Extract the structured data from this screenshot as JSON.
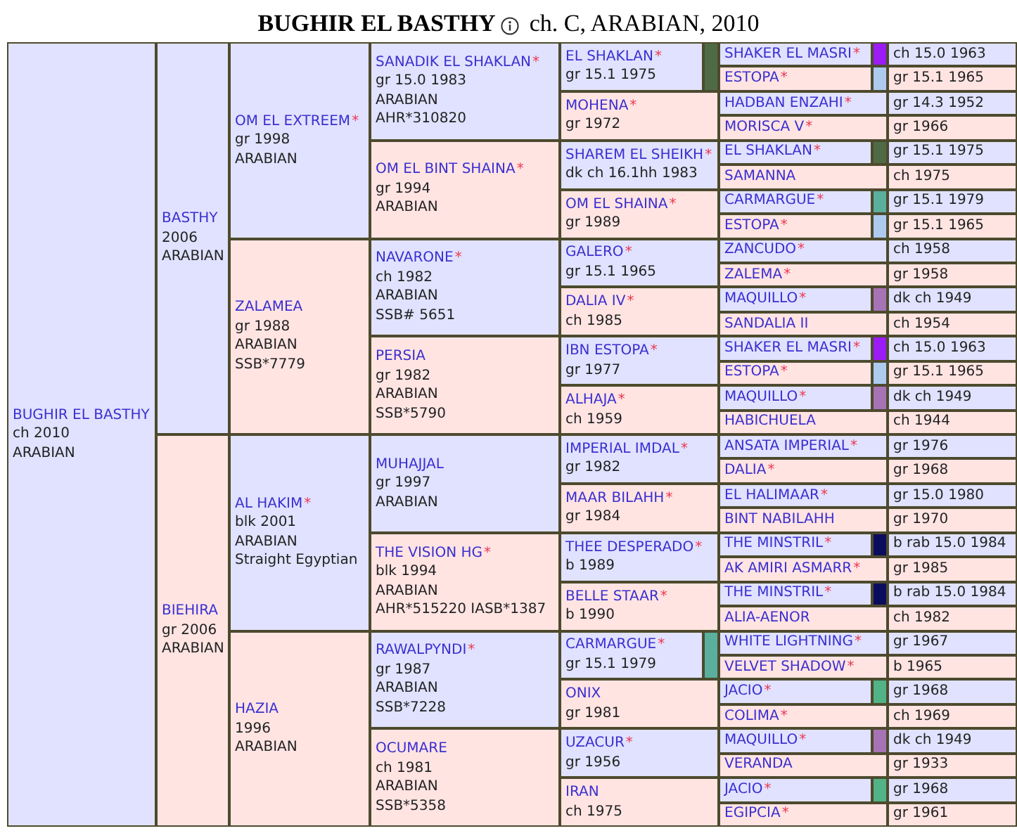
{
  "title": {
    "name": "BUGHIR EL BASTHY",
    "summary": "ch. C, ARABIAN, 2010"
  },
  "pedigree": {
    "name": "BUGHIR EL BASTHY",
    "lines": [
      "ch 2010",
      "ARABIAN"
    ],
    "parents": [
      {
        "name": "BASTHY",
        "lines": [
          "2006",
          "ARABIAN"
        ],
        "parents": [
          {
            "name": "OM EL EXTREEM",
            "star": "*",
            "lines": [
              "gr 1998",
              "ARABIAN"
            ],
            "parents": [
              {
                "name": "SANADIK EL SHAKLAN",
                "star": "*",
                "lines": [
                  "gr 15.0 1983",
                  "ARABIAN",
                  "AHR*310820"
                ],
                "parents": [
                  {
                    "name": "EL SHAKLAN",
                    "star": "*",
                    "lines": [
                      "gr 15.1 1975"
                    ],
                    "color": "#4f6b45",
                    "parents": [
                      {
                        "name": "SHAKER EL MASRI",
                        "star": "*",
                        "lines": [
                          "ch 15.0 1963"
                        ],
                        "color": "#9b1cf5"
                      },
                      {
                        "name": "ESTOPA",
                        "star": "*",
                        "lines": [
                          "gr 15.1 1965"
                        ],
                        "color": "#aecbef"
                      }
                    ]
                  },
                  {
                    "name": "MOHENA",
                    "star": "*",
                    "lines": [
                      "gr 1972"
                    ],
                    "parents": [
                      {
                        "name": "HADBAN ENZAHI",
                        "star": "*",
                        "lines": [
                          "gr 14.3 1952"
                        ]
                      },
                      {
                        "name": "MORISCA V",
                        "star": "*",
                        "lines": [
                          "gr 1966"
                        ]
                      }
                    ]
                  }
                ]
              },
              {
                "name": "OM EL BINT SHAINA",
                "star": "*",
                "lines": [
                  "gr 1994",
                  "ARABIAN"
                ],
                "parents": [
                  {
                    "name": "SHAREM EL SHEIKH",
                    "star": "*",
                    "lines": [
                      "dk ch 16.1hh 1983"
                    ],
                    "parents": [
                      {
                        "name": "EL SHAKLAN",
                        "star": "*",
                        "lines": [
                          "gr 15.1 1975"
                        ],
                        "color": "#4f6b45"
                      },
                      {
                        "name": "SAMANNA",
                        "lines": [
                          "ch 1975"
                        ]
                      }
                    ]
                  },
                  {
                    "name": "OM EL SHAINA",
                    "star": "*",
                    "lines": [
                      "gr 1989"
                    ],
                    "parents": [
                      {
                        "name": "CARMARGUE",
                        "star": "*",
                        "lines": [
                          "gr 15.1 1979"
                        ],
                        "color": "#5aaf9d"
                      },
                      {
                        "name": "ESTOPA",
                        "star": "*",
                        "lines": [
                          "gr 15.1 1965"
                        ],
                        "color": "#aecbef"
                      }
                    ]
                  }
                ]
              }
            ]
          },
          {
            "name": "ZALAMEA",
            "lines": [
              "gr 1988",
              "ARABIAN",
              "SSB*7779"
            ],
            "parents": [
              {
                "name": "NAVARONE",
                "star": "*",
                "lines": [
                  "ch 1982",
                  "ARABIAN",
                  "SSB# 5651"
                ],
                "parents": [
                  {
                    "name": "GALERO",
                    "star": "*",
                    "lines": [
                      "gr 15.1 1965"
                    ],
                    "parents": [
                      {
                        "name": "ZANCUDO",
                        "star": "*",
                        "lines": [
                          "ch 1958"
                        ]
                      },
                      {
                        "name": "ZALEMA",
                        "star": "*",
                        "lines": [
                          "gr 1958"
                        ]
                      }
                    ]
                  },
                  {
                    "name": "DALIA IV",
                    "star": "*",
                    "lines": [
                      "ch 1985"
                    ],
                    "parents": [
                      {
                        "name": "MAQUILLO",
                        "star": "*",
                        "lines": [
                          "dk ch 1949"
                        ],
                        "color": "#a674b5"
                      },
                      {
                        "name": "SANDALIA II",
                        "lines": [
                          "ch 1954"
                        ]
                      }
                    ]
                  }
                ]
              },
              {
                "name": "PERSIA",
                "lines": [
                  "gr 1982",
                  "ARABIAN",
                  "SSB*5790"
                ],
                "parents": [
                  {
                    "name": "IBN ESTOPA",
                    "star": "*",
                    "lines": [
                      "gr 1977"
                    ],
                    "parents": [
                      {
                        "name": "SHAKER EL MASRI",
                        "star": "*",
                        "lines": [
                          "ch 15.0 1963"
                        ],
                        "color": "#9b1cf5"
                      },
                      {
                        "name": "ESTOPA",
                        "star": "*",
                        "lines": [
                          "gr 15.1 1965"
                        ],
                        "color": "#aecbef"
                      }
                    ]
                  },
                  {
                    "name": "ALHAJA",
                    "star": "*",
                    "lines": [
                      "ch 1959"
                    ],
                    "parents": [
                      {
                        "name": "MAQUILLO",
                        "star": "*",
                        "lines": [
                          "dk ch 1949"
                        ],
                        "color": "#a674b5"
                      },
                      {
                        "name": "HABICHUELA",
                        "lines": [
                          "ch 1944"
                        ]
                      }
                    ]
                  }
                ]
              }
            ]
          }
        ]
      },
      {
        "name": "BIEHIRA",
        "lines": [
          "gr 2006",
          "ARABIAN"
        ],
        "parents": [
          {
            "name": "AL HAKIM",
            "star": "*",
            "lines": [
              "blk 2001",
              "ARABIAN",
              "Straight Egyptian"
            ],
            "parents": [
              {
                "name": "MUHAJJAL",
                "lines": [
                  "gr 1997",
                  "ARABIAN"
                ],
                "parents": [
                  {
                    "name": "IMPERIAL IMDAL",
                    "star": "*",
                    "lines": [
                      "gr 1982"
                    ],
                    "parents": [
                      {
                        "name": "ANSATA IMPERIAL",
                        "star": "*",
                        "lines": [
                          "gr 1976"
                        ]
                      },
                      {
                        "name": "DALIA",
                        "star": "*",
                        "lines": [
                          "gr 1968"
                        ]
                      }
                    ]
                  },
                  {
                    "name": "MAAR BILAHH",
                    "star": "*",
                    "lines": [
                      "gr 1984"
                    ],
                    "parents": [
                      {
                        "name": "EL HALIMAAR",
                        "star": "*",
                        "lines": [
                          "gr 15.0 1980"
                        ]
                      },
                      {
                        "name": "BINT NABILAHH",
                        "lines": [
                          "gr 1970"
                        ]
                      }
                    ]
                  }
                ]
              },
              {
                "name": "THE VISION HG",
                "star": "*",
                "lines": [
                  "blk 1994",
                  "ARABIAN",
                  "AHR*515220 IASB*1387"
                ],
                "parents": [
                  {
                    "name": "THEE DESPERADO",
                    "star": "*",
                    "lines": [
                      "b 1989"
                    ],
                    "parents": [
                      {
                        "name": "THE MINSTRIL",
                        "star": "*",
                        "lines": [
                          "b rab 15.0 1984"
                        ],
                        "color": "#0c0c5e"
                      },
                      {
                        "name": "AK AMIRI ASMARR",
                        "star": "*",
                        "lines": [
                          "gr 1985"
                        ]
                      }
                    ]
                  },
                  {
                    "name": "BELLE STAAR",
                    "star": "*",
                    "lines": [
                      "b 1990"
                    ],
                    "parents": [
                      {
                        "name": "THE MINSTRIL",
                        "star": "*",
                        "lines": [
                          "b rab 15.0 1984"
                        ],
                        "color": "#0c0c5e"
                      },
                      {
                        "name": "ALIA-AENOR",
                        "lines": [
                          "ch 1982"
                        ]
                      }
                    ]
                  }
                ]
              }
            ]
          },
          {
            "name": "HAZIA",
            "lines": [
              "1996",
              "ARABIAN"
            ],
            "parents": [
              {
                "name": "RAWALPYNDI",
                "star": "*",
                "lines": [
                  "gr 1987",
                  "ARABIAN",
                  "SSB*7228"
                ],
                "parents": [
                  {
                    "name": "CARMARGUE",
                    "star": "*",
                    "lines": [
                      "gr 15.1 1979"
                    ],
                    "color": "#5aaf9d",
                    "parents": [
                      {
                        "name": "WHITE LIGHTNING",
                        "star": "*",
                        "lines": [
                          "gr 1967"
                        ]
                      },
                      {
                        "name": "VELVET SHADOW",
                        "star": "*",
                        "lines": [
                          "b 1965"
                        ]
                      }
                    ]
                  },
                  {
                    "name": "ONIX",
                    "lines": [
                      "gr 1981"
                    ],
                    "parents": [
                      {
                        "name": "JACIO",
                        "star": "*",
                        "lines": [
                          "gr 1968"
                        ],
                        "color": "#52b386"
                      },
                      {
                        "name": "COLIMA",
                        "star": "*",
                        "lines": [
                          "ch 1969"
                        ]
                      }
                    ]
                  }
                ]
              },
              {
                "name": "OCUMARE",
                "lines": [
                  "ch 1981",
                  "ARABIAN",
                  "SSB*5358"
                ],
                "parents": [
                  {
                    "name": "UZACUR",
                    "star": "*",
                    "lines": [
                      "gr 1956"
                    ],
                    "parents": [
                      {
                        "name": "MAQUILLO",
                        "star": "*",
                        "lines": [
                          "dk ch 1949"
                        ],
                        "color": "#a674b5"
                      },
                      {
                        "name": "VERANDA",
                        "lines": [
                          "gr 1933"
                        ]
                      }
                    ]
                  },
                  {
                    "name": "IRAN",
                    "lines": [
                      "ch 1975"
                    ],
                    "parents": [
                      {
                        "name": "JACIO",
                        "star": "*",
                        "lines": [
                          "gr 1968"
                        ],
                        "color": "#52b386"
                      },
                      {
                        "name": "EGIPCIA",
                        "star": "*",
                        "lines": [
                          "gr 1961"
                        ]
                      }
                    ]
                  }
                ]
              }
            ]
          }
        ]
      }
    ]
  }
}
